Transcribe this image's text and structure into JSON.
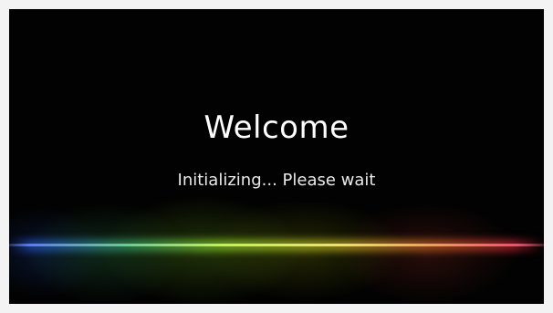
{
  "screen": {
    "title": "Welcome",
    "status": "Initializing... Please wait"
  },
  "colors": {
    "background": "#020202",
    "text": "#ffffff",
    "accent_line": [
      "#5a7df0",
      "#66d08a",
      "#c6ef5a",
      "#f0e06a",
      "#f19a5a",
      "#ef4f6a"
    ]
  }
}
